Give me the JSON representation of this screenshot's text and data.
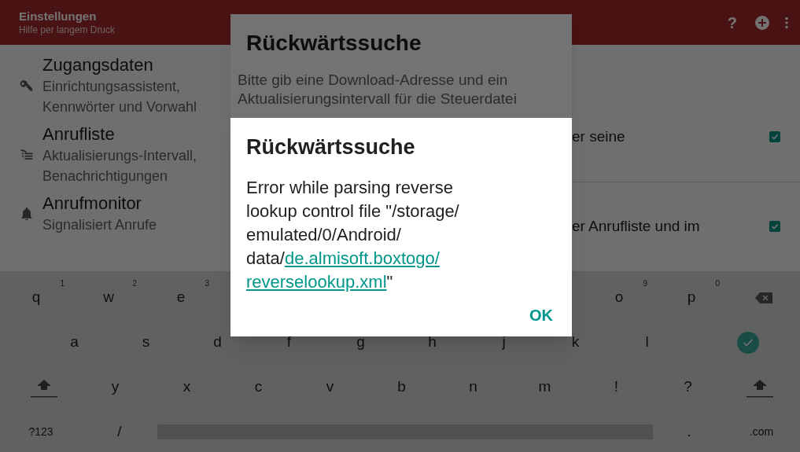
{
  "toolbar": {
    "title": "Einstellungen",
    "subtitle": "Hilfe per langem Druck",
    "actions": [
      {
        "kind": "help",
        "glyph": "?"
      },
      {
        "kind": "add"
      },
      {
        "kind": "overflow"
      }
    ]
  },
  "settings_left": [
    {
      "kind": "key",
      "title": "Zugangsdaten",
      "summary": "Einrichtungsassistent, Kennwörter und Vorwahl"
    },
    {
      "kind": "list",
      "title": "Anrufliste",
      "summary": "Aktualisierungs-Intervall, Benachrichtigungen"
    },
    {
      "kind": "bell",
      "title": "Anrufmonitor",
      "summary": "Signalisiert Anrufe"
    }
  ],
  "settings_right": [
    {
      "text": "er seine",
      "checked": true
    },
    {
      "text": "er Anrufliste und im",
      "checked": true
    }
  ],
  "back_dialog": {
    "title": "Rückwärtssuche",
    "message": "Bitte gib eine Download-Adresse und ein Aktualisierungsintervall für die Steuerdatei"
  },
  "dialog": {
    "title": "Rückwärtssuche",
    "lines": [
      [
        {
          "text": "Error while parsing reverse"
        }
      ],
      [
        {
          "text": "lookup control file \"/storage/"
        }
      ],
      [
        {
          "text": "emulated/0/Android/"
        }
      ],
      [
        {
          "text": "data/"
        },
        {
          "text": "de.almisoft.boxtogo/",
          "link": true
        }
      ],
      [
        {
          "text": "reverselookup.xml",
          "link": true
        },
        {
          "text": "\""
        }
      ]
    ],
    "button": "OK"
  },
  "keyboard": {
    "row_1_left": [
      {
        "label": "q",
        "hint": "1"
      },
      {
        "label": "w",
        "hint": "2"
      },
      {
        "label": "e",
        "hint": "3"
      }
    ],
    "row_1_right": [
      {
        "label": "o",
        "hint": "9"
      },
      {
        "label": "p",
        "hint": "0"
      },
      {
        "kind": "backspace"
      }
    ],
    "row_2": [
      {
        "label": "a"
      },
      {
        "label": "s"
      },
      {
        "label": "d"
      },
      {
        "label": "f"
      },
      {
        "label": "g"
      },
      {
        "label": "h"
      },
      {
        "label": "j"
      },
      {
        "label": "k"
      },
      {
        "label": "l"
      },
      {
        "kind": "enter"
      }
    ],
    "row_3": [
      {
        "kind": "shift"
      },
      {
        "label": "y"
      },
      {
        "label": "x"
      },
      {
        "label": "c"
      },
      {
        "label": "v"
      },
      {
        "label": "b"
      },
      {
        "label": "n"
      },
      {
        "label": "m"
      },
      {
        "label": "!"
      },
      {
        "label": "?"
      },
      {
        "kind": "shift"
      }
    ],
    "row_4": [
      {
        "label": "?123"
      },
      {
        "label": "/"
      },
      {
        "kind": "space"
      },
      {
        "label": "."
      },
      {
        "label": ".com"
      }
    ]
  }
}
